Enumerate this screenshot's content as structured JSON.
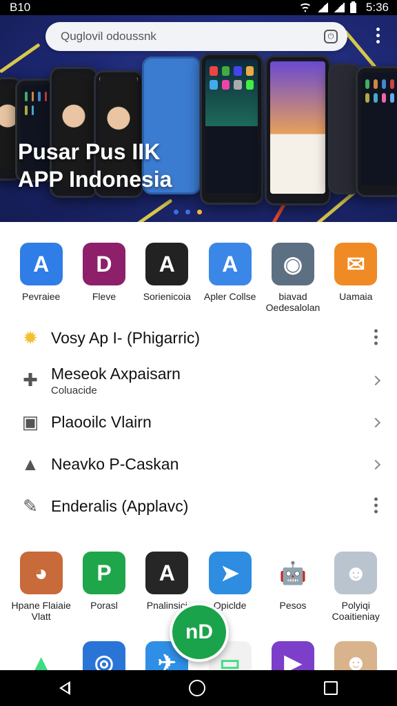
{
  "status_bar": {
    "time_left": "B10",
    "time_right": "5:36"
  },
  "banner": {
    "search_placeholder": "Quglovil odoussnk",
    "title_line1": "Pusar Pus IIK",
    "title_line2": "APP Indonesia",
    "page_dots": [
      "#3b6fe0",
      "#3b6fe0",
      "#f5b82e"
    ]
  },
  "apps_top": [
    {
      "label": "Pevraiee",
      "color": "#2f7de6",
      "glyph": "A",
      "icon": "arrow-app-icon"
    },
    {
      "label": "Fleve",
      "color": "#8e1f6b",
      "glyph": "D",
      "icon": "d-app-icon"
    },
    {
      "label": "Sorienicoia",
      "color": "#222222",
      "glyph": "A",
      "icon": "triangle-app-icon"
    },
    {
      "label": "Apler Collse",
      "color": "#3a87e8",
      "glyph": "A",
      "icon": "a-app-icon"
    },
    {
      "label": "biavad Oedesalolan",
      "color": "#5d6f82",
      "glyph": "◉",
      "icon": "figure-app-icon"
    },
    {
      "label": "Uamaia",
      "color": "#f08a24",
      "glyph": "✉",
      "icon": "envelope-app-icon"
    }
  ],
  "list": [
    {
      "title": "Vosy Ap I-  (Phigarric)",
      "subtitle": "",
      "action": "more",
      "icon": "sun-icon",
      "icon_color": "#f2c12e"
    },
    {
      "title": "Meseok Axpaisarn",
      "subtitle": "Coluacide",
      "action": "chevron",
      "icon": "puzzle-icon",
      "icon_color": "#555555"
    },
    {
      "title": "Plaooilc Vlairn",
      "subtitle": "",
      "action": "chevron",
      "icon": "square-icon",
      "icon_color": "#555555"
    },
    {
      "title": "Neavko P-Caskan",
      "subtitle": "",
      "action": "chevron",
      "icon": "warning-icon",
      "icon_color": "#555555"
    },
    {
      "title": "Enderalis (Applavc)",
      "subtitle": "",
      "action": "more",
      "icon": "edit-icon",
      "icon_color": "#555555"
    }
  ],
  "apps_bottom": [
    {
      "label": "Hpane Flaiaie Vlatt",
      "color": "#c86a3a",
      "glyph": "◕",
      "icon": "owl-app-icon"
    },
    {
      "label": "Porasl",
      "color": "#1fa64a",
      "glyph": "P",
      "icon": "p-app-icon"
    },
    {
      "label": "Pnalinsici",
      "color": "#262626",
      "glyph": "A",
      "icon": "prism-app-icon"
    },
    {
      "label": "Opiclde",
      "color": "#2e8de0",
      "glyph": "➤",
      "icon": "send-app-icon"
    },
    {
      "label": "Pesos",
      "color": "#ffffff",
      "glyph": "🤖",
      "icon": "android-app-icon"
    },
    {
      "label": "Polyiqi Coaitieniay",
      "color": "#b9c4cf",
      "glyph": "☻",
      "icon": "person-app-icon"
    }
  ],
  "apps_partial": [
    {
      "color": "#ffffff",
      "glyph": "▲",
      "icon": "triangle-partial-icon"
    },
    {
      "color": "#2a74d8",
      "glyph": "◎",
      "icon": "compass-app-icon"
    },
    {
      "color": "#2f8fe6",
      "glyph": "✈",
      "icon": "plane-app-icon"
    },
    {
      "color": "#f1f1f1",
      "glyph": "▭",
      "icon": "box-app-icon"
    },
    {
      "color": "#7b3fc9",
      "glyph": "▶",
      "icon": "play-app-icon"
    },
    {
      "color": "#d9b38c",
      "glyph": "☻",
      "icon": "portrait-app-icon"
    }
  ],
  "fab": {
    "glyph": "nD"
  }
}
